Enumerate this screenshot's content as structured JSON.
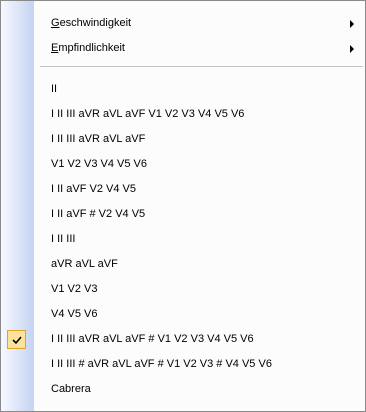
{
  "menu": {
    "submenus": [
      {
        "prefix": "G",
        "rest": "eschwindigkeit"
      },
      {
        "prefix": "E",
        "rest": "mpfindlichkeit"
      }
    ],
    "items": [
      {
        "label": "II"
      },
      {
        "label": "I II III aVR aVL aVF V1 V2 V3 V4 V5 V6"
      },
      {
        "label": "I II III aVR aVL aVF"
      },
      {
        "label": "V1 V2 V3 V4 V5 V6"
      },
      {
        "label": "I II aVF V2 V4 V5"
      },
      {
        "label": "I II aVF # V2 V4 V5"
      },
      {
        "label": "I II III"
      },
      {
        "label": "aVR aVL aVF"
      },
      {
        "label": "V1 V2 V3"
      },
      {
        "label": "V4 V5 V6"
      },
      {
        "label": "I II III aVR aVL aVF # V1 V2 V3 V4 V5 V6",
        "checked": true
      },
      {
        "label": "I II III # aVR aVL aVF # V1 V2 V3 # V4 V5 V6"
      },
      {
        "label": "Cabrera"
      }
    ],
    "colors": {
      "gutter_start": "#f7f9ff",
      "gutter_end": "#c4d3f2",
      "highlight": "#fde39a"
    }
  }
}
